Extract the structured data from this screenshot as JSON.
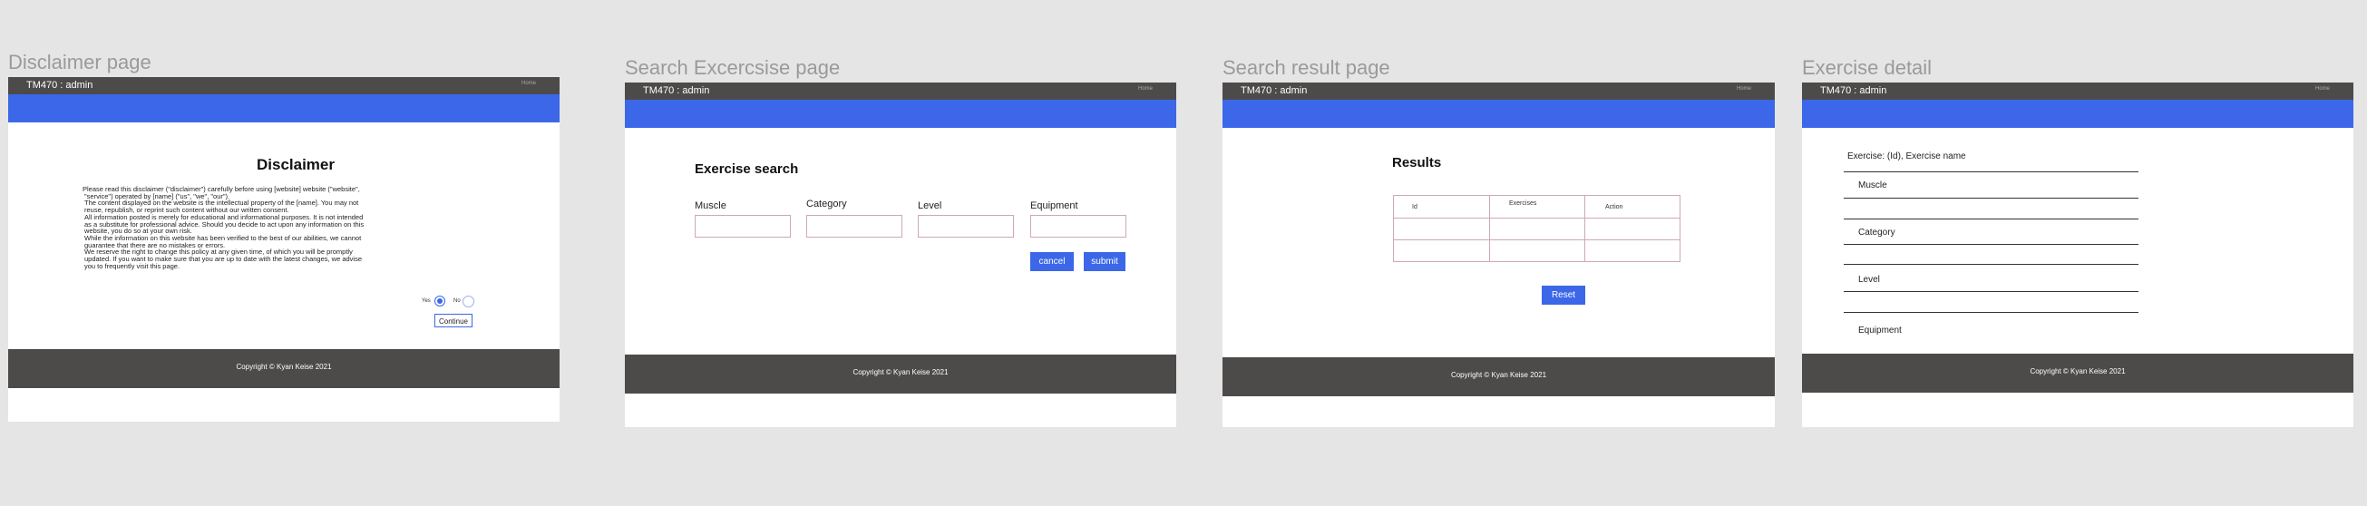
{
  "frames": {
    "disclaimer": {
      "title": "Disclaimer page"
    },
    "search": {
      "title": "Search Excercsise page"
    },
    "results": {
      "title": "Search result page"
    },
    "detail": {
      "title": "Exercise detail"
    }
  },
  "common": {
    "brand": "TM470 : admin",
    "topbar_right": "Home",
    "footer": "Copyright © Kyan Keise 2021"
  },
  "disclaimer": {
    "heading": "Disclaimer",
    "lines": [
      "Please read this disclaimer (\"disclaimer\") carefully before using [website] website (\"website\",",
      "\"service\") operated by [name] (\"us\", \"we\", \"our\").",
      "The content displayed on the website is the intellectual property of the [name]. You may not",
      "reuse, republish, or reprint such content without our written consent.",
      "All information posted is merely for educational and informational purposes. It is not intended",
      "as a substitute for professional advice. Should you decide to act upon any information on this",
      "website, you do so at your own risk.",
      "While the information on this website has been verified to the best of our abilities, we cannot",
      "guarantee that there are no mistakes or errors.",
      "We reserve the right to change this policy at any given time, of which you will be promptly",
      "updated. If you want to make sure that you are up to date with the latest changes, we advise",
      "you to frequently visit this page."
    ],
    "yes_label": "Yes",
    "no_label": "No",
    "continue": "Continue"
  },
  "search": {
    "heading": "Exercise search",
    "fields": [
      {
        "label": "Muscle"
      },
      {
        "label": "Category"
      },
      {
        "label": "Level"
      },
      {
        "label": "Equipment"
      }
    ],
    "cancel": "cancel",
    "submit": "submit"
  },
  "results": {
    "heading": "Results",
    "columns": [
      "Id",
      "Exercises",
      "Action"
    ],
    "reset": "Reset"
  },
  "detail": {
    "title": "Exercise: (Id), Exercise name",
    "fields": [
      "Muscle",
      "Category",
      "Level",
      "Equipment"
    ]
  }
}
